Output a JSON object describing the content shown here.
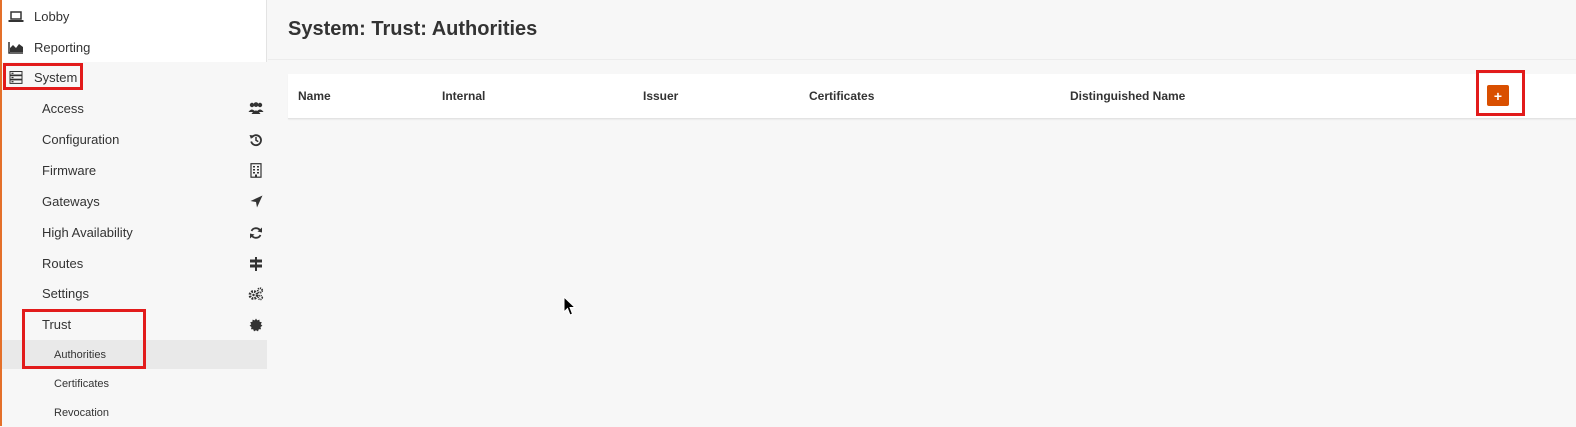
{
  "sidebar": {
    "top_items": [
      {
        "label": "Lobby",
        "icon": "laptop-icon"
      },
      {
        "label": "Reporting",
        "icon": "area-chart-icon"
      },
      {
        "label": "System",
        "icon": "server-icon"
      }
    ],
    "system_items": [
      {
        "label": "Access",
        "icon": "users-icon"
      },
      {
        "label": "Configuration",
        "icon": "history-icon"
      },
      {
        "label": "Firmware",
        "icon": "building-icon"
      },
      {
        "label": "Gateways",
        "icon": "location-arrow-icon"
      },
      {
        "label": "High Availability",
        "icon": "refresh-icon"
      },
      {
        "label": "Routes",
        "icon": "signpost-icon"
      },
      {
        "label": "Settings",
        "icon": "cogs-icon"
      },
      {
        "label": "Trust",
        "icon": "certificate-icon"
      }
    ],
    "trust_items": [
      {
        "label": "Authorities"
      },
      {
        "label": "Certificates"
      },
      {
        "label": "Revocation"
      }
    ]
  },
  "page": {
    "title": "System: Trust: Authorities"
  },
  "table": {
    "columns": [
      "Name",
      "Internal",
      "Issuer",
      "Certificates",
      "Distinguished Name"
    ],
    "add_label": "+"
  },
  "colors": {
    "accent": "#e4702a",
    "add_button": "#d94f00",
    "highlight": "#e21b1b"
  }
}
